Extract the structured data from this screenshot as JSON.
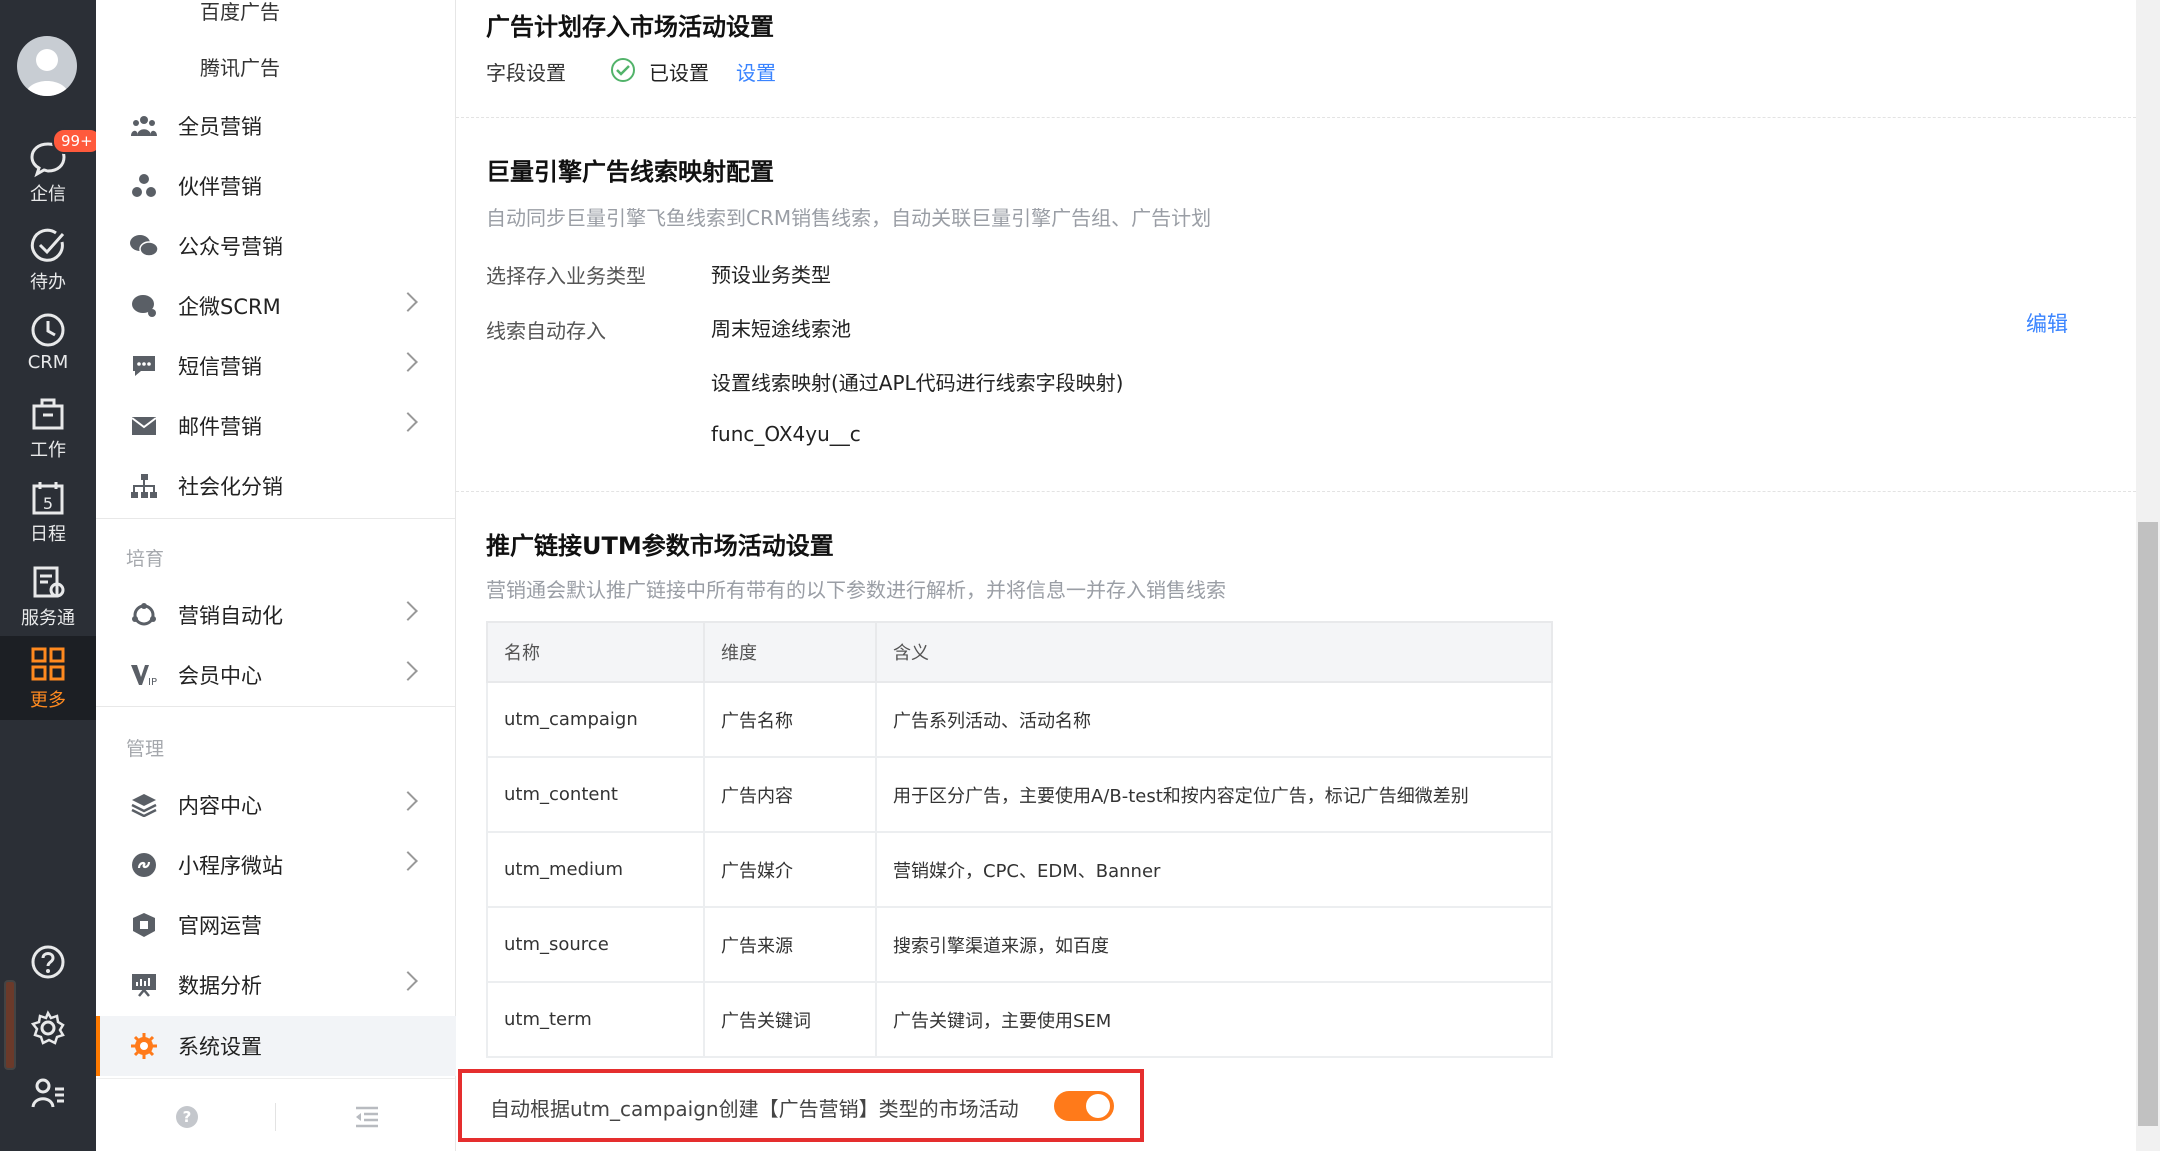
{
  "rail": {
    "items": [
      {
        "label": "企信",
        "badge": "99+"
      },
      {
        "label": "待办"
      },
      {
        "label": "CRM"
      },
      {
        "label": "工作"
      },
      {
        "label": "日程"
      },
      {
        "label": "服务通"
      },
      {
        "label": "更多"
      }
    ],
    "calendar_day": "5"
  },
  "menu": {
    "sub_items": [
      "百度广告",
      "腾讯广告"
    ],
    "items_a": [
      {
        "label": "全员营销"
      },
      {
        "label": "伙伴营销"
      },
      {
        "label": "公众号营销"
      },
      {
        "label": "企微SCRM"
      },
      {
        "label": "短信营销"
      },
      {
        "label": "邮件营销"
      },
      {
        "label": "社会化分销"
      }
    ],
    "group_b": "培育",
    "items_b": [
      {
        "label": "营销自动化"
      },
      {
        "label": "会员中心"
      }
    ],
    "group_c": "管理",
    "items_c": [
      {
        "label": "内容中心"
      },
      {
        "label": "小程序微站"
      },
      {
        "label": "官网运营"
      },
      {
        "label": "数据分析"
      },
      {
        "label": "系统设置"
      }
    ]
  },
  "section1": {
    "title": "广告计划存入市场活动设置",
    "field_label": "字段设置",
    "status": "已设置",
    "action": "设置"
  },
  "section2": {
    "title": "巨量引擎广告线索映射配置",
    "desc": "自动同步巨量引擎飞鱼线索到CRM销售线索，自动关联巨量引擎广告组、广告计划",
    "label_type": "选择存入业务类型",
    "value_type": "预设业务类型",
    "label_auto": "线索自动存入",
    "value_pool": "周末短途线索池",
    "value_mapping": "设置线索映射(通过APL代码进行线索字段映射)",
    "value_func": "func_OX4yu__c",
    "edit": "编辑"
  },
  "section3": {
    "title": "推广链接UTM参数市场活动设置",
    "desc": "营销通会默认推广链接中所有带有的以下参数进行解析，并将信息一并存入销售线索",
    "columns": [
      "名称",
      "维度",
      "含义"
    ],
    "rows": [
      [
        "utm_campaign",
        "广告名称",
        "广告系列活动、活动名称"
      ],
      [
        "utm_content",
        "广告内容",
        "用于区分广告，主要使用A/B-test和按内容定位广告，标记广告细微差别"
      ],
      [
        "utm_medium",
        "广告媒介",
        "营销媒介，CPC、EDM、Banner"
      ],
      [
        "utm_source",
        "广告来源",
        "搜索引擎渠道来源，如百度"
      ],
      [
        "utm_term",
        "广告关键词",
        "广告关键词，主要使用SEM"
      ]
    ],
    "auto_create_text": "自动根据utm_campaign创建【广告营销】类型的市场活动",
    "auto_create_enabled": true
  },
  "colors": {
    "accent": "#ff7a1a",
    "link": "#3a84ff",
    "highlight": "#e52e2e",
    "rail_bg": "#2b2f36"
  }
}
